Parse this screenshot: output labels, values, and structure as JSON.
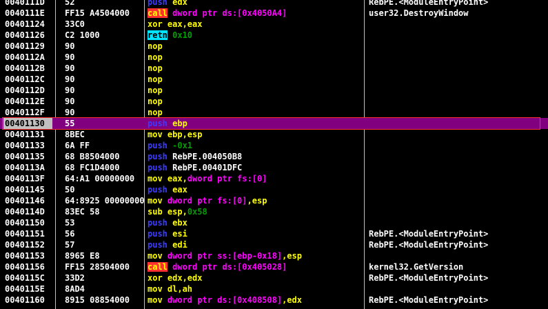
{
  "colors": {
    "background": "#000000",
    "selected_row": "#800080",
    "selection_border": "#ff3030",
    "push_mnemonic": "#3c3cff",
    "call_mnemonic_bg": "#ff3030",
    "retn_mnemonic_bg": "#00e5ff",
    "register": "#ffff00",
    "memory_operand": "#ff00ff",
    "immediate": "#00a000"
  },
  "rows": [
    {
      "addr": "0040111D",
      "hex": "52",
      "comment": "RebPE.<ModuleEntryPoint>",
      "asm": [
        {
          "t": "push",
          "c": "push"
        },
        {
          "t": " edx",
          "c": "reg"
        }
      ]
    },
    {
      "addr": "0040111E",
      "hex": "FF15 A4504000",
      "comment": "user32.DestroyWindow",
      "asm": [
        {
          "t": "call",
          "c": "call"
        },
        {
          "t": " dword ptr ds:[0x4050A4]",
          "c": "mem"
        }
      ]
    },
    {
      "addr": "00401124",
      "hex": "33C0",
      "comment": "",
      "asm": [
        {
          "t": "xor",
          "c": "xor"
        },
        {
          "t": " eax,eax",
          "c": "reg"
        }
      ]
    },
    {
      "addr": "00401126",
      "hex": "C2 1000",
      "comment": "",
      "asm": [
        {
          "t": "retn",
          "c": "retn"
        },
        {
          "t": " 0x10",
          "c": "imm"
        }
      ]
    },
    {
      "addr": "00401129",
      "hex": "90",
      "comment": "",
      "asm": [
        {
          "t": "nop",
          "c": "nop"
        }
      ]
    },
    {
      "addr": "0040112A",
      "hex": "90",
      "comment": "",
      "asm": [
        {
          "t": "nop",
          "c": "nop"
        }
      ]
    },
    {
      "addr": "0040112B",
      "hex": "90",
      "comment": "",
      "asm": [
        {
          "t": "nop",
          "c": "nop"
        }
      ]
    },
    {
      "addr": "0040112C",
      "hex": "90",
      "comment": "",
      "asm": [
        {
          "t": "nop",
          "c": "nop"
        }
      ]
    },
    {
      "addr": "0040112D",
      "hex": "90",
      "comment": "",
      "asm": [
        {
          "t": "nop",
          "c": "nop"
        }
      ]
    },
    {
      "addr": "0040112E",
      "hex": "90",
      "comment": "",
      "asm": [
        {
          "t": "nop",
          "c": "nop"
        }
      ]
    },
    {
      "addr": "0040112F",
      "hex": "90",
      "comment": "",
      "asm": [
        {
          "t": "nop",
          "c": "nop"
        }
      ]
    },
    {
      "addr": "00401130",
      "hex": "55",
      "comment": "",
      "selected": true,
      "asm": [
        {
          "t": "push",
          "c": "push"
        },
        {
          "t": " ebp",
          "c": "reg"
        }
      ]
    },
    {
      "addr": "00401131",
      "hex": "8BEC",
      "comment": "",
      "asm": [
        {
          "t": "mov",
          "c": "mov"
        },
        {
          "t": " ebp,esp",
          "c": "reg"
        }
      ]
    },
    {
      "addr": "00401133",
      "hex": "6A FF",
      "comment": "",
      "asm": [
        {
          "t": "push",
          "c": "push"
        },
        {
          "t": " -0x1",
          "c": "imm"
        }
      ]
    },
    {
      "addr": "00401135",
      "hex": "68 B8504000",
      "comment": "",
      "asm": [
        {
          "t": "push",
          "c": "push"
        },
        {
          "t": " RebPE.004050B8",
          "c": "name"
        }
      ]
    },
    {
      "addr": "0040113A",
      "hex": "68 FC1D4000",
      "comment": "",
      "asm": [
        {
          "t": "push",
          "c": "push"
        },
        {
          "t": " RebPE.00401DFC",
          "c": "name"
        }
      ]
    },
    {
      "addr": "0040113F",
      "hex": "64:A1 00000000",
      "comment": "",
      "asm": [
        {
          "t": "mov",
          "c": "mov"
        },
        {
          "t": " eax,",
          "c": "reg"
        },
        {
          "t": "dword ptr fs:[0]",
          "c": "mem"
        }
      ]
    },
    {
      "addr": "00401145",
      "hex": "50",
      "comment": "",
      "asm": [
        {
          "t": "push",
          "c": "push"
        },
        {
          "t": " eax",
          "c": "reg"
        }
      ]
    },
    {
      "addr": "00401146",
      "hex": "64:8925 00000000",
      "comment": "",
      "asm": [
        {
          "t": "mov",
          "c": "mov"
        },
        {
          "t": " dword ptr fs:[0]",
          "c": "mem"
        },
        {
          "t": ",esp",
          "c": "reg"
        }
      ]
    },
    {
      "addr": "0040114D",
      "hex": "83EC 58",
      "comment": "",
      "asm": [
        {
          "t": "sub",
          "c": "sub"
        },
        {
          "t": " esp,",
          "c": "reg"
        },
        {
          "t": "0x58",
          "c": "imm"
        }
      ]
    },
    {
      "addr": "00401150",
      "hex": "53",
      "comment": "",
      "asm": [
        {
          "t": "push",
          "c": "push"
        },
        {
          "t": " ebx",
          "c": "reg"
        }
      ]
    },
    {
      "addr": "00401151",
      "hex": "56",
      "comment": "RebPE.<ModuleEntryPoint>",
      "asm": [
        {
          "t": "push",
          "c": "push"
        },
        {
          "t": " esi",
          "c": "reg"
        }
      ]
    },
    {
      "addr": "00401152",
      "hex": "57",
      "comment": "RebPE.<ModuleEntryPoint>",
      "asm": [
        {
          "t": "push",
          "c": "push"
        },
        {
          "t": " edi",
          "c": "reg"
        }
      ]
    },
    {
      "addr": "00401153",
      "hex": "8965 E8",
      "comment": "",
      "asm": [
        {
          "t": "mov",
          "c": "mov"
        },
        {
          "t": " dword ptr ss:[ebp-0x18]",
          "c": "mem"
        },
        {
          "t": ",esp",
          "c": "reg"
        }
      ]
    },
    {
      "addr": "00401156",
      "hex": "FF15 28504000",
      "comment": "kernel32.GetVersion",
      "asm": [
        {
          "t": "call",
          "c": "call"
        },
        {
          "t": " dword ptr ds:[0x405028]",
          "c": "mem"
        }
      ]
    },
    {
      "addr": "0040115C",
      "hex": "33D2",
      "comment": "RebPE.<ModuleEntryPoint>",
      "asm": [
        {
          "t": "xor",
          "c": "xor"
        },
        {
          "t": " edx,edx",
          "c": "reg"
        }
      ]
    },
    {
      "addr": "0040115E",
      "hex": "8AD4",
      "comment": "",
      "asm": [
        {
          "t": "mov",
          "c": "mov"
        },
        {
          "t": " dl,ah",
          "c": "reg"
        }
      ]
    },
    {
      "addr": "00401160",
      "hex": "8915 08854000",
      "comment": "RebPE.<ModuleEntryPoint>",
      "asm": [
        {
          "t": "mov",
          "c": "mov"
        },
        {
          "t": " dword ptr ds:[0x408508]",
          "c": "mem"
        },
        {
          "t": ",edx",
          "c": "reg"
        }
      ]
    }
  ]
}
